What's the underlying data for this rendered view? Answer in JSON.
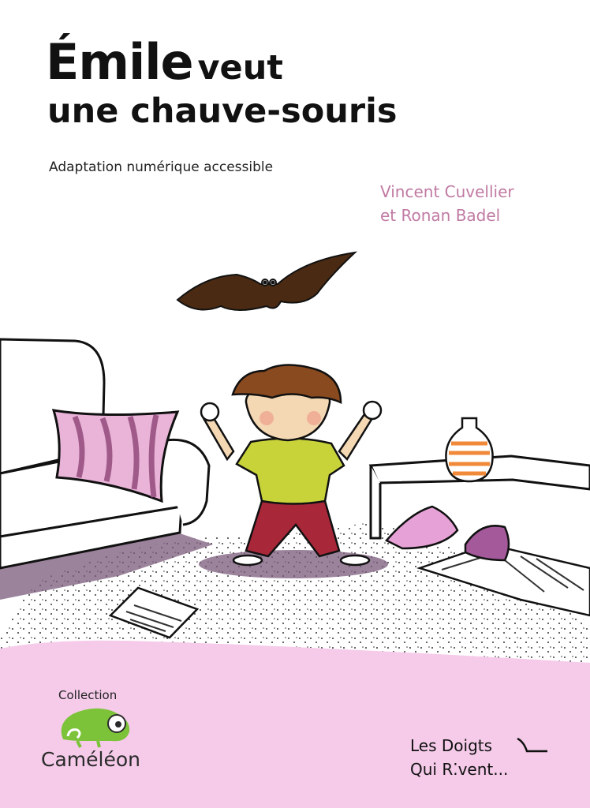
{
  "title": {
    "line1_main": "Émile",
    "line1_rest": "veut",
    "line2": "une chauve-souris"
  },
  "subtitle": "Adaptation numérique accessible",
  "authors": [
    "Vincent Cuvellier",
    "et Ronan Badel"
  ],
  "collection": {
    "label": "Collection",
    "name": "Caméléon"
  },
  "publisher": {
    "line1": "Les Doigts",
    "line2": "Qui R⁚vent..."
  },
  "colors": {
    "authors": "#c07aa3",
    "footer_band": "#f5cbe9",
    "pillow": "#e9b4d8",
    "logo_green": "#7cc33a",
    "shirt": "#c8d33a",
    "trousers": "#a8283a",
    "hair": "#8a4a1f",
    "bat": "#4a2a12"
  },
  "icons": [
    "bat-icon",
    "chameleon-logo-icon"
  ]
}
